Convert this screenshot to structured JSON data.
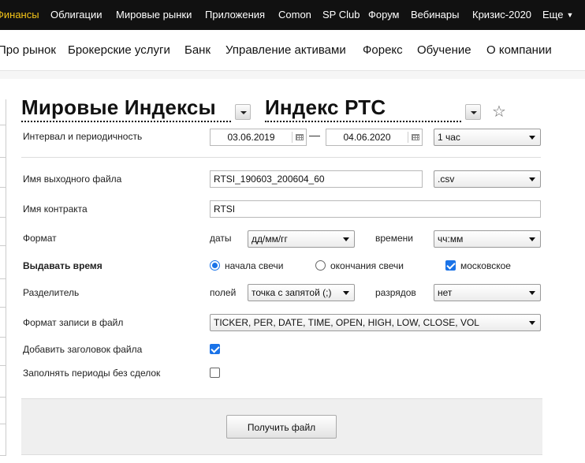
{
  "top_nav": {
    "items": [
      "Финансы",
      "Облигации",
      "Мировые рынки",
      "Приложения",
      "Comon",
      "SP Club",
      "Форум",
      "Вебинары",
      "Кризис-2020",
      "Еще"
    ],
    "active": "Финансы"
  },
  "main_nav": {
    "items": [
      "Про рынок",
      "Брокерские услуги",
      "Банк",
      "Управление активами",
      "Форекс",
      "Обучение",
      "О компании"
    ]
  },
  "header": {
    "market": "Мировые Индексы",
    "instrument": "Индекс РТС",
    "favorite_icon": "star-icon"
  },
  "form": {
    "interval": {
      "label": "Интервал и периодичность",
      "date_from": "03.06.2019",
      "date_to": "04.06.2020",
      "period": "1 час"
    },
    "output_file": {
      "label": "Имя выходного файла",
      "value": "RTSI_190603_200604_60",
      "extension": ".csv"
    },
    "contract": {
      "label": "Имя контракта",
      "value": "RTSI"
    },
    "format": {
      "label": "Формат",
      "date_label": "даты",
      "date_value": "дд/мм/гг",
      "time_label": "времени",
      "time_value": "чч:мм"
    },
    "time_output": {
      "label": "Выдавать время",
      "option_start": "начала свечи",
      "option_end": "окончания свечи",
      "moscow_label": "московское",
      "selected": "начала свечи",
      "moscow_checked": true
    },
    "separator": {
      "label": "Разделитель",
      "fields_label": "полей",
      "fields_value": "точка с запятой (;)",
      "digits_label": "разрядов",
      "digits_value": "нет"
    },
    "record_format": {
      "label": "Формат записи в файл",
      "value": "TICKER, PER, DATE, TIME, OPEN, HIGH, LOW, CLOSE, VOL"
    },
    "add_header": {
      "label": "Добавить заголовок файла",
      "checked": true
    },
    "fill_periods": {
      "label": "Заполнять периоды без сделок",
      "checked": false
    },
    "submit_label": "Получить файл"
  }
}
